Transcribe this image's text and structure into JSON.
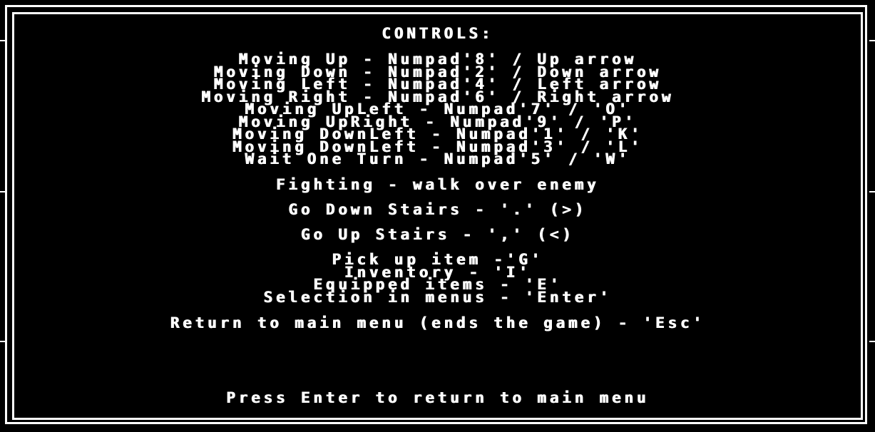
{
  "title": "CONTROLS:",
  "movement": [
    "Moving Up - Numpad'8' / Up arrow",
    "Moving Down - Numpad'2' / Down arrow",
    "Moving Left - Numpad'4' / Left arrow",
    "Moving Right - Numpad'6' / Right arrow",
    "Moving UpLeft - Numpad'7' / 'O'",
    "Moving UpRight - Numpad'9' / 'P'",
    "Moving DownLeft - Numpad'1' / 'K'",
    "Moving DownLeft - Numpad'3' / 'L'",
    "Wait One Turn - Numpad'5' / 'W'"
  ],
  "fighting": "Fighting - walk over enemy",
  "stairs_down": "Go Down Stairs - '.' (>)",
  "stairs_up": "Go Up Stairs - ',' (<)",
  "items": [
    "Pick up item -'G'",
    "Inventory - 'I'",
    "Equipped items - 'E'",
    "Selection in menus - 'Enter'"
  ],
  "return_main": "Return to main menu (ends the game) - 'Esc'",
  "prompt": "Press Enter to return to main menu",
  "colors": {
    "background": "#000000",
    "foreground": "#ffffff"
  }
}
